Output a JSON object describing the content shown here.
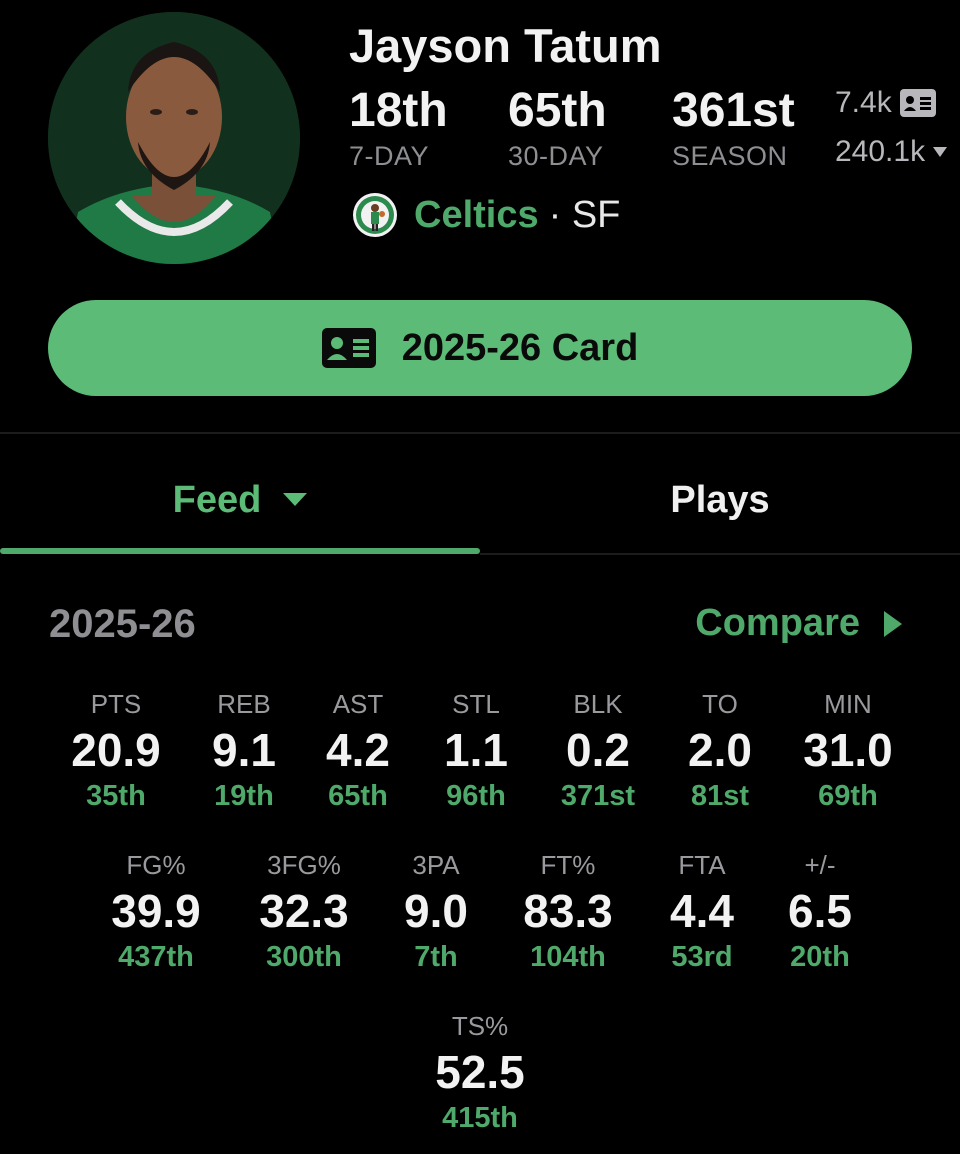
{
  "player": {
    "name": "Jayson Tatum",
    "team": "Celtics",
    "position_sep": "· SF"
  },
  "ranks": [
    {
      "value": "18th",
      "label": "7-DAY"
    },
    {
      "value": "65th",
      "label": "30-DAY"
    },
    {
      "value": "361st",
      "label": "SEASON"
    }
  ],
  "mini_stats": {
    "cards": "7.4k",
    "views": "240.1k"
  },
  "card_button": {
    "label": "2025-26 Card",
    "icon": "id-card-icon"
  },
  "tabs": [
    {
      "label": "Feed",
      "active": true
    },
    {
      "label": "Plays",
      "active": false
    }
  ],
  "stats_section": {
    "season": "2025-26",
    "compare_label": "Compare"
  },
  "stats_row1": [
    {
      "label": "PTS",
      "value": "20.9",
      "rank": "35th"
    },
    {
      "label": "REB",
      "value": "9.1",
      "rank": "19th"
    },
    {
      "label": "AST",
      "value": "4.2",
      "rank": "65th"
    },
    {
      "label": "STL",
      "value": "1.1",
      "rank": "96th"
    },
    {
      "label": "BLK",
      "value": "0.2",
      "rank": "371st"
    },
    {
      "label": "TO",
      "value": "2.0",
      "rank": "81st"
    },
    {
      "label": "MIN",
      "value": "31.0",
      "rank": "69th"
    }
  ],
  "stats_row2": [
    {
      "label": "FG%",
      "value": "39.9",
      "rank": "437th"
    },
    {
      "label": "3FG%",
      "value": "32.3",
      "rank": "300th"
    },
    {
      "label": "3PA",
      "value": "9.0",
      "rank": "7th"
    },
    {
      "label": "FT%",
      "value": "83.3",
      "rank": "104th"
    },
    {
      "label": "FTA",
      "value": "4.4",
      "rank": "53rd"
    },
    {
      "label": "+/-",
      "value": "6.5",
      "rank": "20th"
    }
  ],
  "stats_row3": [
    {
      "label": "TS%",
      "value": "52.5",
      "rank": "415th"
    }
  ],
  "colors": {
    "accent": "#5cbb76",
    "accent_text": "#4ea96a",
    "background": "#000000",
    "muted": "#8e8e93"
  }
}
